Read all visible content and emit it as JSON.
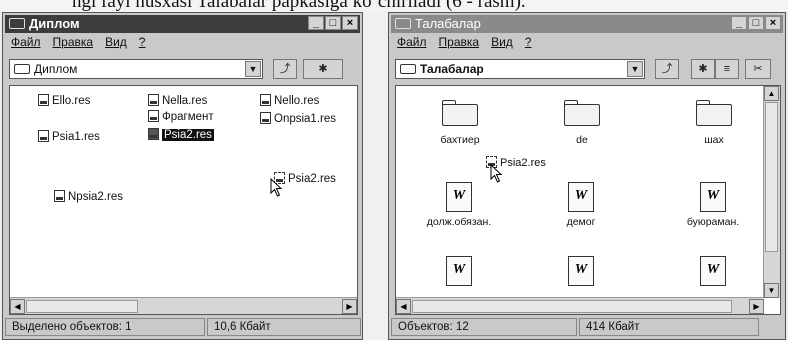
{
  "top_caption": "ngi fayl nusxasi Talabalar papkasiga ko`chiriladi (6 - rasm).",
  "window1": {
    "title": "Диплом",
    "menu": [
      "Файл",
      "Правка",
      "Вид",
      "?"
    ],
    "address": "Диплом",
    "toolbar_icons": [
      "up-folder-icon",
      "new-folder-icon"
    ],
    "files": [
      "Ello.res",
      "Nella.res",
      "Nello.res",
      "Фрагмент",
      "Onpsia1.res",
      "Psia1.res",
      "Psia2.res",
      "Npsia2.res"
    ],
    "drag_label": "Psia2.res",
    "status": {
      "selected": "Выделено объектов: 1",
      "size": "10,6 Кбайт"
    }
  },
  "window2": {
    "title": "Талабалар",
    "menu": [
      "Файл",
      "Правка",
      "Вид",
      "?"
    ],
    "address": "Талабалар",
    "toolbar_icons": [
      "up-folder-icon",
      "new-folder-icon",
      "map-drive-icon",
      "cut-icon"
    ],
    "folders": [
      "бахтиер",
      "de",
      "шах"
    ],
    "documents": [
      "долж.обязан.",
      "демог",
      "буюраман.",
      "",
      "",
      ""
    ],
    "drag_label": "Psia2.res",
    "status": {
      "objects": "Объектов: 12",
      "size": "414 Кбайт"
    }
  },
  "title_buttons": [
    "_",
    "□",
    "×"
  ]
}
